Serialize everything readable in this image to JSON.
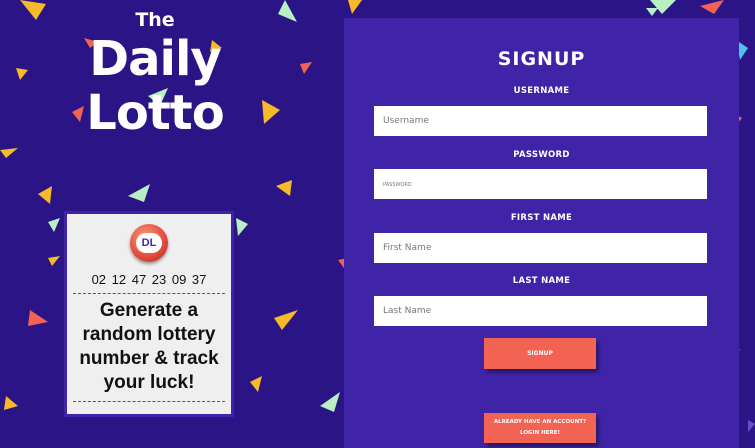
{
  "brand": {
    "line1": "The",
    "line2": "Daily",
    "line3": "Lotto"
  },
  "ticket": {
    "badge_text": "DL",
    "numbers": "02 12 47 23 09 37",
    "tagline_lines": [
      "Generate a",
      "random lottery",
      "number & track",
      "your luck!"
    ]
  },
  "form": {
    "title": "SIGNUP",
    "username": {
      "label": "USERNAME",
      "placeholder": "Username"
    },
    "password": {
      "label": "PASSWORD",
      "placeholder": "PASSWORD"
    },
    "first_name": {
      "label": "FIRST NAME",
      "placeholder": "First Name"
    },
    "last_name": {
      "label": "LAST NAME",
      "placeholder": "Last Name"
    },
    "signup_button": "SIGNUP",
    "login_button": {
      "line1": "ALREADY HAVE AN ACCOUNT?",
      "line2": "LOGIN HERE!"
    }
  },
  "colors": {
    "background": "#2a1486",
    "panel": "#3f24a8",
    "button": "#f36354",
    "confetti": [
      "#f5b92a",
      "#f36354",
      "#b8f0c4",
      "#7c6ad6",
      "#6a4ec9",
      "#4fc0e8",
      "#a06bd8"
    ]
  }
}
